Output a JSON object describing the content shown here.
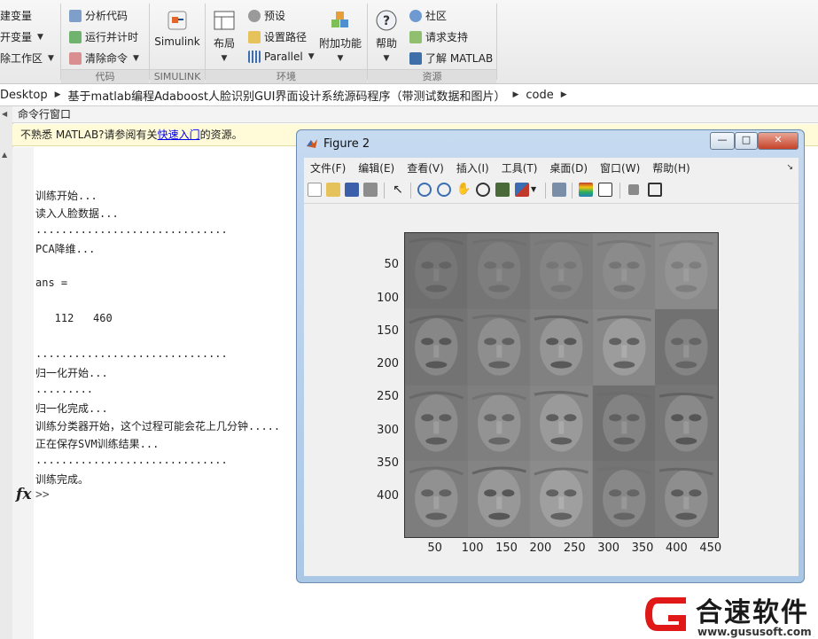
{
  "ribbon": {
    "col1": [
      "建变量",
      "开变量",
      "除工作区"
    ],
    "col2": [
      "分析代码",
      "运行并计时",
      "清除命令"
    ],
    "simulink_label": "Simulink",
    "layout_label": "布局",
    "col3": [
      "预设",
      "设置路径",
      "Parallel"
    ],
    "addons_label": "附加功能",
    "help_label": "帮助",
    "col4": [
      "社区",
      "请求支持",
      "了解 MATLAB"
    ],
    "groups": [
      "代码",
      "SIMULINK",
      "环境",
      "资源"
    ]
  },
  "address": [
    "Desktop",
    "基于matlab编程Adaboost人脸识别GUI界面设计系统源码程序（带测试数据和图片）",
    "code"
  ],
  "command_window": {
    "title": "命令行窗口",
    "notice_before": "不熟悉 MATLAB?请参阅有关",
    "notice_link": "快速入门",
    "notice_after": "的资源。",
    "lines": [
      "训练开始...",
      "读入人脸数据...",
      "..............................",
      "PCA降维...",
      "",
      "ans =",
      "",
      "   112   460",
      "",
      "..............................",
      "归一化开始...",
      ".........",
      "归一化完成...",
      "训练分类器开始，这个过程可能会花上几分钟.....",
      "正在保存SVM训练结果...",
      "..............................",
      "训练完成。"
    ],
    "fx": "fx",
    "prompt": ">>"
  },
  "figure": {
    "title": "Figure 2",
    "buttons": [
      "—",
      "□",
      "✕"
    ],
    "menus": [
      "文件(F)",
      "编辑(E)",
      "查看(V)",
      "插入(I)",
      "工具(T)",
      "桌面(D)",
      "窗口(W)",
      "帮助(H)"
    ],
    "plot": {
      "yticks": [
        "50",
        "100",
        "150",
        "200",
        "250",
        "300",
        "350",
        "400"
      ],
      "xticks": [
        "50",
        "100",
        "150",
        "200",
        "250",
        "300",
        "350",
        "400",
        "450"
      ],
      "rows": 4,
      "cols": 5
    }
  },
  "watermark": {
    "name": "合速软件",
    "url": "www.gususoft.com"
  }
}
